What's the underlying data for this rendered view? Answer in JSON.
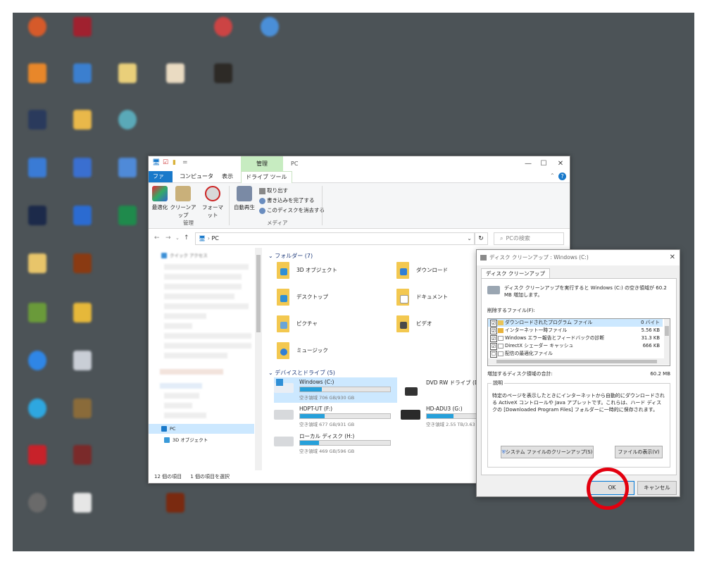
{
  "explorer": {
    "title": "PC",
    "context_tab_group": "管理",
    "tabs": [
      "ファイル",
      "コンピュータ",
      "表示",
      "ドライブ ツール"
    ],
    "ribbon": {
      "optimize": "最適化",
      "cleanup": "クリーンアップ",
      "format": "フォーマット",
      "autoplay": "自動再生",
      "eject": "取り出す",
      "finish_burning": "書き込みを完了する",
      "erase_disc": "このディスクを消去する",
      "group_manage": "管理",
      "group_media": "メディア"
    },
    "address": "PC",
    "search_placeholder": "PCの検索",
    "nav": {
      "quick_access": "クイック アクセス",
      "pc": "PC",
      "objects3d": "3D オブジェクト"
    },
    "folders_header": "フォルダー (7)",
    "folders": [
      "3D オブジェクト",
      "ダウンロード",
      "デスクトップ",
      "ドキュメント",
      "ピクチャ",
      "ビデオ",
      "ミュージック"
    ],
    "drives_header": "デバイスとドライブ (5)",
    "drives": [
      {
        "name": "Windows (C:)",
        "space": "空き領域 706 GB/930 GB",
        "used": 0.24
      },
      {
        "name": "DVD RW ドライブ (D:)",
        "space": "",
        "used": 0
      },
      {
        "name": "HDPT-UT (F:)",
        "space": "空き領域 677 GB/931 GB",
        "used": 0.27
      },
      {
        "name": "HD-ADU3 (G:)",
        "space": "空き領域 2.55 TB/3.63 TB",
        "used": 0.3
      },
      {
        "name": "ローカル ディスク (H:)",
        "space": "空き領域 469 GB/596 GB",
        "used": 0.21
      }
    ],
    "status_count": "12 個の項目",
    "status_selected": "1 個の項目を選択"
  },
  "dialog": {
    "title": "ディスク クリーンアップ : Windows (C:)",
    "tab": "ディスク クリーンアップ",
    "intro": "ディスク クリーンアップを実行すると Windows (C:) の空き領域が 60.2 MB 増加します。",
    "files_label": "削除するファイル(F):",
    "files": [
      {
        "name": "ダウンロードされたプログラム ファイル",
        "size": "0 バイト",
        "checked": "☑"
      },
      {
        "name": "インターネット一時ファイル",
        "size": "5.56 KB",
        "checked": "☑"
      },
      {
        "name": "Windows エラー報告とフィードバックの診断",
        "size": "31.3 KB",
        "checked": "☑"
      },
      {
        "name": "DirectX シェーダー キャッシュ",
        "size": "666 KB",
        "checked": "☑"
      },
      {
        "name": "配信の最適化ファイル",
        "size": "",
        "checked": "☐"
      }
    ],
    "total_label": "増加するディスク領域の合計:",
    "total_value": "60.2 MB",
    "desc_label": "説明",
    "description": "特定のページを表示したときにインターネットから自動的にダウンロードされる ActiveX コントロールや Java アプレットです。これらは、ハード ディスクの [Downloaded Program Files] フォルダーに一時的に保存されます。",
    "sys_clean_button": "システム ファイルのクリーンアップ(S)",
    "view_files_button": "ファイルの表示(V)",
    "ok": "OK",
    "cancel": "キャンセル"
  },
  "colors": {
    "desktop": "#4c5357",
    "accent": "#1979ca",
    "drive_bar": "#26a0da",
    "highlight_ring": "#e3000f"
  }
}
